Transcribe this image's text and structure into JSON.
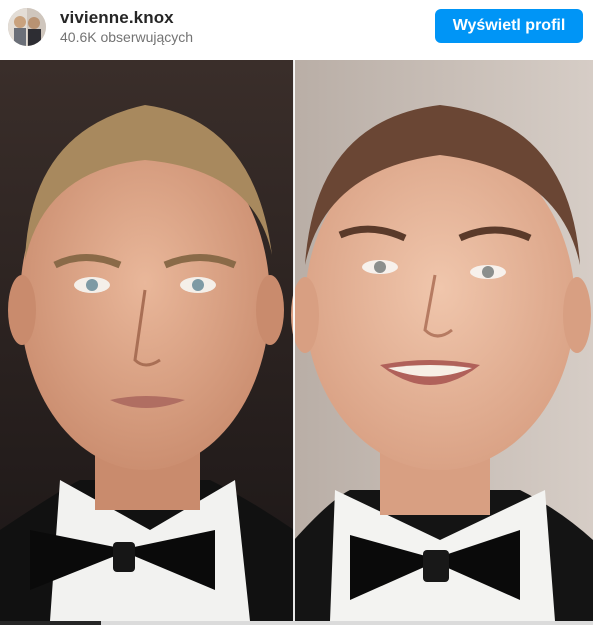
{
  "post": {
    "username": "vivienne.knox",
    "followers": "40.6K obserwujących",
    "view_profile_label": "Wyświetl profil"
  },
  "media": {
    "description": "",
    "progress": 0.17
  },
  "colors": {
    "button": "#0095f6",
    "text": "#262626",
    "muted": "#737373"
  }
}
